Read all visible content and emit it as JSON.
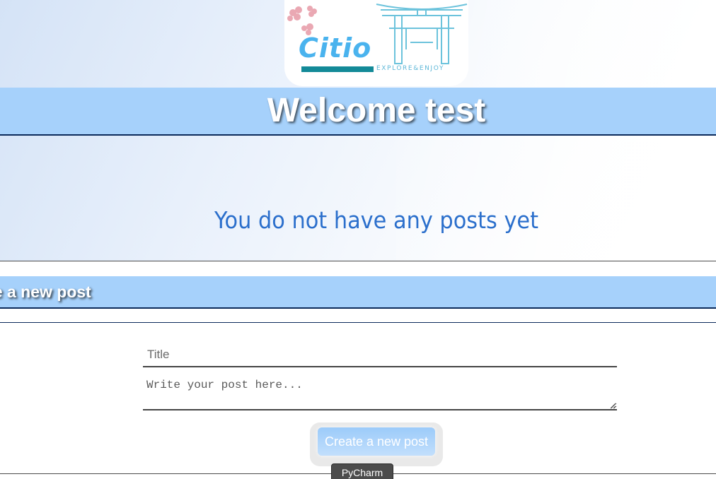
{
  "logo": {
    "name": "Citio",
    "tagline": "EXPLORE&ENJOY",
    "colors": {
      "text": "#4ab3ee",
      "bar": "#138a98",
      "gate": "#6cc3dc",
      "blossom": "#e79aa6"
    }
  },
  "header": {
    "welcome_text": "Welcome test"
  },
  "posts": {
    "empty_message": "You do not have any posts yet"
  },
  "new_post": {
    "heading": "Create a new post",
    "title_placeholder": "Title",
    "body_placeholder": "Write your post here...",
    "submit_label": "Create a new post"
  },
  "tooltip": {
    "text": "PyCharm"
  },
  "colors": {
    "banner": "#a6d1fb",
    "banner_border": "#0b2a5a",
    "empty_text": "#2b6fcc"
  }
}
